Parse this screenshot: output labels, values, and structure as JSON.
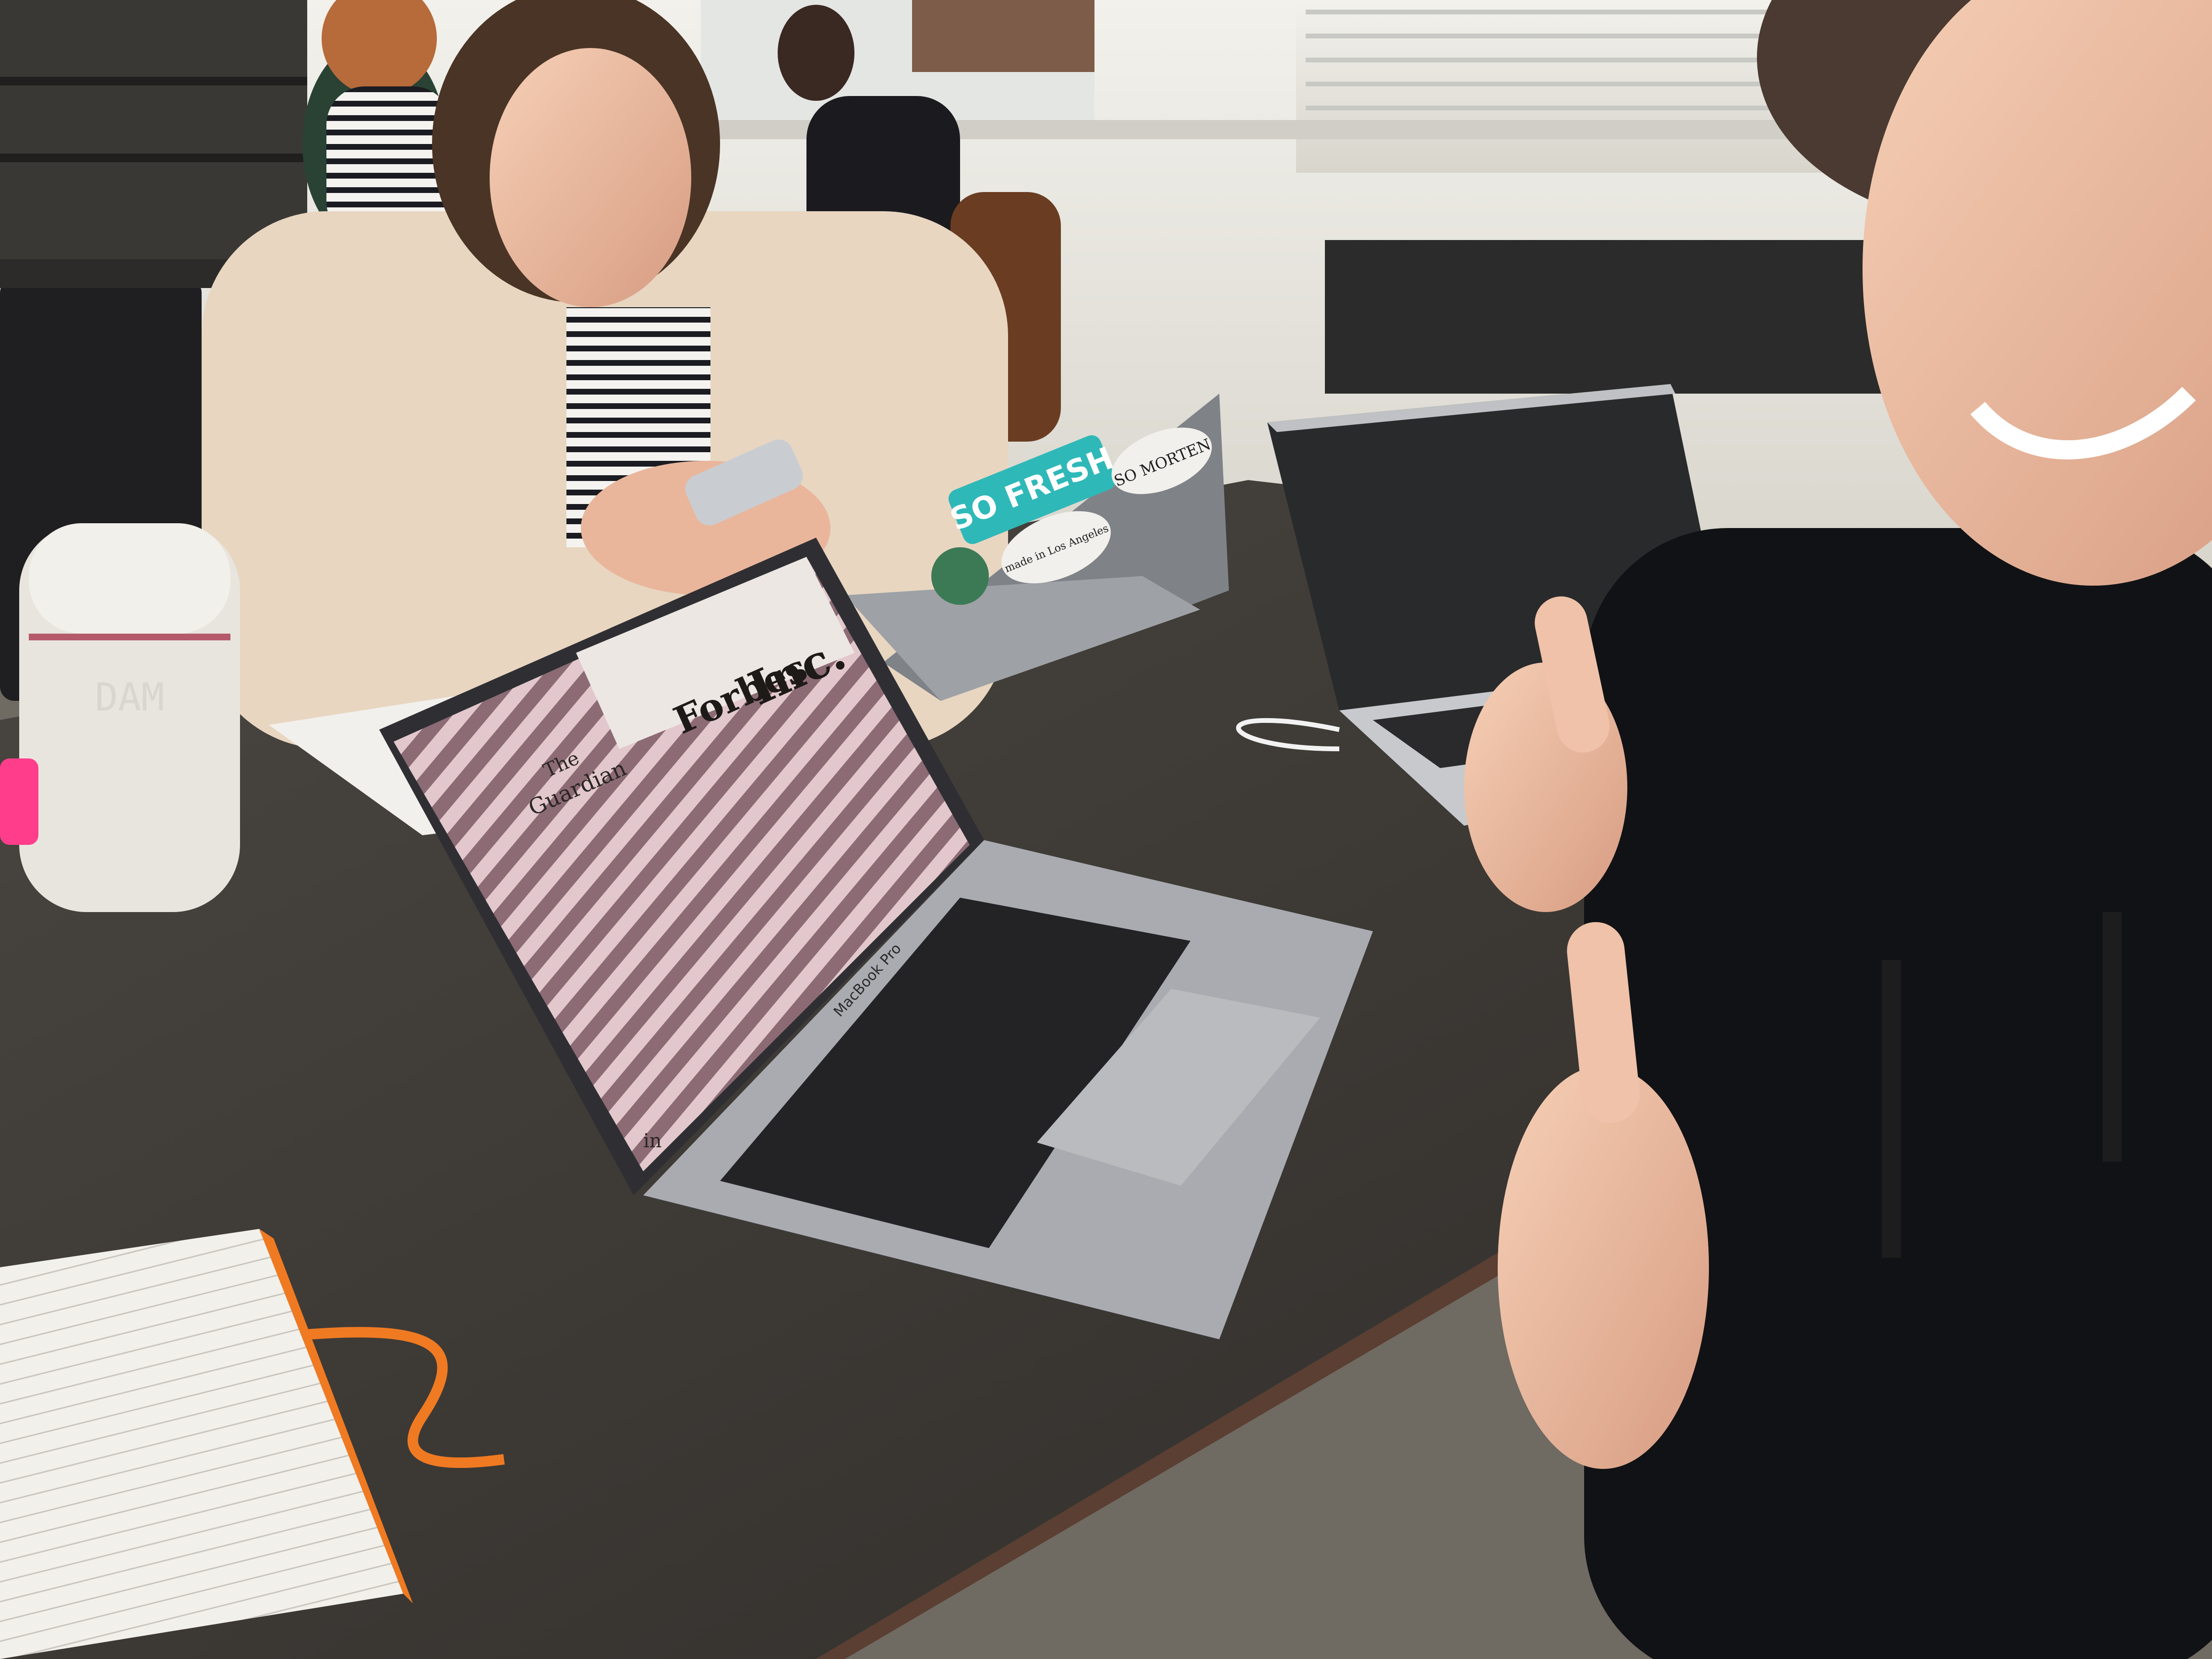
{
  "scene": {
    "bottle_text": "DAM",
    "laptop_screen": {
      "logo_line1": "The",
      "logo_line2": "Guardian",
      "logo_forbes": "Forbes",
      "logo_inc": "Inc.",
      "corner_mark": "in"
    },
    "laptop_model": "MacBook Pro",
    "stickers": [
      {
        "text": "SO FRESH"
      },
      {
        "text": "SO MORTEN"
      },
      {
        "text": "made in Los Angeles"
      }
    ]
  },
  "colors": {
    "table": "#3d3a36",
    "wall": "#e9e7e1",
    "window": "#f6f6f2",
    "laptop_silver": "#aeb0b4",
    "notebook_accent": "#f07a22",
    "highlighter": "#ff3d8b",
    "sticker_teal": "#2fb8b8"
  }
}
